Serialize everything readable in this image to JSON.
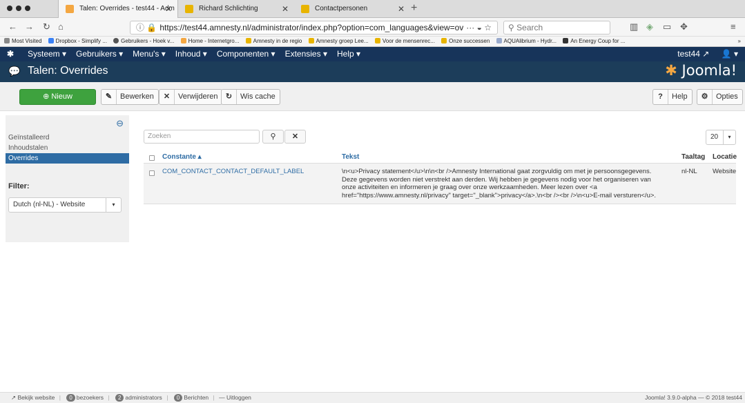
{
  "browser": {
    "tabs": [
      {
        "title": "Talen: Overrides - test44 - Adm",
        "active": true
      },
      {
        "title": "Richard Schlichting",
        "active": false
      },
      {
        "title": "Contactpersonen",
        "active": false
      }
    ],
    "url": "https://test44.amnesty.nl/administrator/index.php?option=com_languages&view=over",
    "url_menu": "···",
    "search_placeholder": "Search",
    "bookmarks": [
      "Most Visited",
      "Dropbox - Simplify ...",
      "Gebruikers - Hoek v...",
      "Home - Internetgro...",
      "Amnesty in de regio",
      "Amnesty groep Lee...",
      "Voor de mensenrec...",
      "Onze successen",
      "AQUAlibrium - Hydr...",
      "An Energy Coup for ..."
    ]
  },
  "joomla_nav": {
    "menus": [
      "Systeem ▾",
      "Gebruikers ▾",
      "Menu's ▾",
      "Inhoud ▾",
      "Componenten ▾",
      "Extensies ▾",
      "Help ▾"
    ],
    "site_name": "test44 ↗",
    "user": "👤 ▾"
  },
  "header": {
    "title": "Talen: Overrides",
    "brand": "Joomla!"
  },
  "toolbar": {
    "new": "Nieuw",
    "edit": "Bewerken",
    "delete": "Verwijderen",
    "clear_cache": "Wis cache",
    "help": "Help",
    "options": "Opties"
  },
  "sidebar": {
    "items": [
      {
        "label": "Geïnstalleerd"
      },
      {
        "label": "Inhoudstalen"
      },
      {
        "label": "Overrides"
      }
    ],
    "filter_label": "Filter:",
    "filter_value": "Dutch (nl-NL) - Website"
  },
  "list": {
    "search_placeholder": "Zoeken",
    "limit": "20",
    "headers": {
      "constant": "Constante ▴",
      "text": "Tekst",
      "lang": "Taaltag",
      "location": "Locatie"
    },
    "rows": [
      {
        "constant": "COM_CONTACT_CONTACT_DEFAULT_LABEL",
        "text_lines": [
          "\\n<u>Privacy statement</u>\\n\\n<br />Amnesty International gaat zorgvuldig om met je persoonsgegevens.",
          "Deze gegevens worden niet verstrekt aan derden. Wij hebben je gegevens nodig voor het organiseren van",
          "onze activiteiten en informeren je graag over onze werkzaamheden. Meer lezen over <a",
          "href=\"https://www.amnesty.nl/privacy\" target=\"_blank\">privacy</a>.\\n<br /><br />\\n<u>E-mail versturen</u>."
        ],
        "lang": "nl-NL",
        "location": "Website"
      }
    ]
  },
  "footer": {
    "view_site": "Bekijk website",
    "visitors_count": "0",
    "visitors": "bezoekers",
    "admins_count": "2",
    "admins": "administrators",
    "messages_count": "0",
    "messages": "Berichten",
    "logout": "Uitloggen",
    "version": "Joomla! 3.9.0-alpha — © 2018 test44"
  }
}
